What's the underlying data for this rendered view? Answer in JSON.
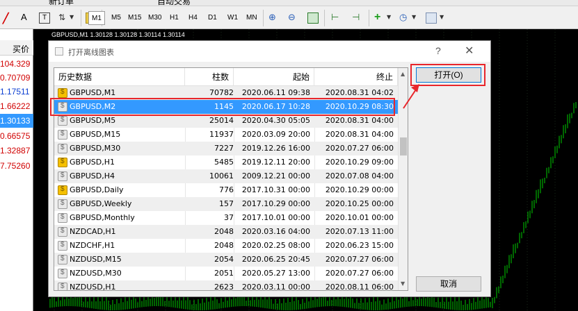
{
  "toolbar": {
    "row1_fragments": [
      "新订单",
      "自动交易"
    ],
    "font_button": "A",
    "timeframes": [
      "M1",
      "M5",
      "M15",
      "M30",
      "H1",
      "H4",
      "D1",
      "W1",
      "MN"
    ],
    "active_timeframe": "M1"
  },
  "market_watch": {
    "header": "买价",
    "prices": [
      {
        "value": "104.329",
        "color": "red"
      },
      {
        "value": "0.70709",
        "color": "red"
      },
      {
        "value": "1.17511",
        "color": "blue"
      },
      {
        "value": "1.66222",
        "color": "red"
      },
      {
        "value": "1.30133",
        "color": "selected"
      },
      {
        "value": "0.66575",
        "color": "red"
      },
      {
        "value": "1.32887",
        "color": "red"
      },
      {
        "value": "7.75260",
        "color": "red"
      }
    ]
  },
  "chart": {
    "title": "GBPUSD,M1  1.30128 1.30128 1.30114 1.30114",
    "colors": {
      "background": "#000000",
      "candles": "#00cc00",
      "grid": "#1a2a1a"
    }
  },
  "dialog": {
    "title": "打开离线图表",
    "help_label": "?",
    "close_label": "✕",
    "columns": {
      "history": "历史数据",
      "bars": "柱数",
      "start": "起始",
      "end": "终止"
    },
    "open_button": "打开(O)",
    "cancel_button": "取消",
    "rows": [
      {
        "name": "GBPUSD,M1",
        "bars": "70782",
        "start": "2020.06.11 09:38",
        "end": "2020.08.31 04:02",
        "icon": "gold"
      },
      {
        "name": "GBPUSD,M2",
        "bars": "1145",
        "start": "2020.06.17 10:28",
        "end": "2020.10.29 08:30",
        "icon": "gray",
        "selected": true
      },
      {
        "name": "GBPUSD,M5",
        "bars": "25014",
        "start": "2020.04.30 05:05",
        "end": "2020.08.31 04:00",
        "icon": "gray"
      },
      {
        "name": "GBPUSD,M15",
        "bars": "11937",
        "start": "2020.03.09 20:00",
        "end": "2020.08.31 04:00",
        "icon": "gray"
      },
      {
        "name": "GBPUSD,M30",
        "bars": "7227",
        "start": "2019.12.26 16:00",
        "end": "2020.07.27 06:00",
        "icon": "gray"
      },
      {
        "name": "GBPUSD,H1",
        "bars": "5485",
        "start": "2019.12.11 20:00",
        "end": "2020.10.29 09:00",
        "icon": "gold"
      },
      {
        "name": "GBPUSD,H4",
        "bars": "10061",
        "start": "2009.12.21 00:00",
        "end": "2020.07.08 04:00",
        "icon": "gray"
      },
      {
        "name": "GBPUSD,Daily",
        "bars": "776",
        "start": "2017.10.31 00:00",
        "end": "2020.10.29 00:00",
        "icon": "gold"
      },
      {
        "name": "GBPUSD,Weekly",
        "bars": "157",
        "start": "2017.10.29 00:00",
        "end": "2020.10.25 00:00",
        "icon": "gray"
      },
      {
        "name": "GBPUSD,Monthly",
        "bars": "37",
        "start": "2017.10.01 00:00",
        "end": "2020.10.01 00:00",
        "icon": "gray"
      },
      {
        "name": "NZDCAD,H1",
        "bars": "2048",
        "start": "2020.03.16 04:00",
        "end": "2020.07.13 11:00",
        "icon": "gray"
      },
      {
        "name": "NZDCHF,H1",
        "bars": "2048",
        "start": "2020.02.25 08:00",
        "end": "2020.06.23 15:00",
        "icon": "gray"
      },
      {
        "name": "NZDUSD,M15",
        "bars": "2054",
        "start": "2020.06.25 20:45",
        "end": "2020.07.27 06:00",
        "icon": "gray"
      },
      {
        "name": "NZDUSD,M30",
        "bars": "2051",
        "start": "2020.05.27 13:00",
        "end": "2020.07.27 06:00",
        "icon": "gray"
      },
      {
        "name": "NZDUSD,H1",
        "bars": "2623",
        "start": "2020.03.11 00:00",
        "end": "2020.08.11 06:00",
        "icon": "gray"
      }
    ]
  }
}
